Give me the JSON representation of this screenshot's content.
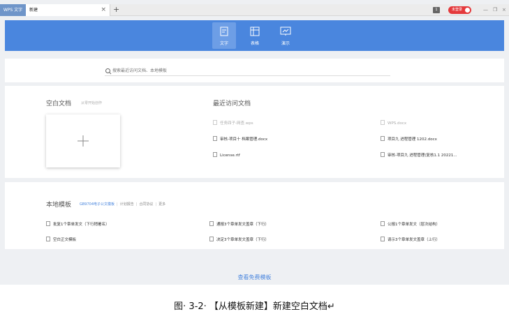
{
  "titlebar": {
    "app_tab": "WPS 文字",
    "doc_tab": "新建",
    "close_glyph": "×",
    "add_glyph": "+",
    "badge_num": "1",
    "login": "未登录",
    "minimize": "—",
    "restore": "❐",
    "close": "×"
  },
  "modes": [
    {
      "label": "文字",
      "icon": "document-icon",
      "active": true
    },
    {
      "label": "表格",
      "icon": "table-icon",
      "active": false
    },
    {
      "label": "演示",
      "icon": "presentation-icon",
      "active": false
    }
  ],
  "search": {
    "placeholder": "搜索最近访问文档、本地模板"
  },
  "blank": {
    "title": "空白文档",
    "subtitle": "从零开始创作"
  },
  "recent": {
    "title": "最近访问文档",
    "items": [
      {
        "name": "任务四子-网查.wps",
        "dim": true
      },
      {
        "name": "WPS.docx",
        "dim": true
      },
      {
        "name": "审核-项目十 档案管理.docx",
        "dim": false
      },
      {
        "name": "项目九  进程管理   1202.docx",
        "dim": false
      },
      {
        "name": "License.rtf",
        "dim": false
      },
      {
        "name": "审核-项目九 进程管理(复核1.1 20221...",
        "dim": false
      }
    ]
  },
  "templates": {
    "title": "本地模板",
    "tabs": [
      "GB9704电子公文模板",
      "计划报告",
      "合同协议",
      "更多"
    ],
    "items": [
      "批复1个章单发文（下行稍署名）",
      "通报3个章单发文盖章（下行）",
      "公报1个章单发文（层次结构）",
      "空白正文模板",
      "决定3个章单发文盖章（下行）",
      "请示3个章单发文盖章（上行）"
    ]
  },
  "free_templates": "查看免费模板",
  "caption": "图· 3-2· 【从模板新建】新建空白文档↵"
}
